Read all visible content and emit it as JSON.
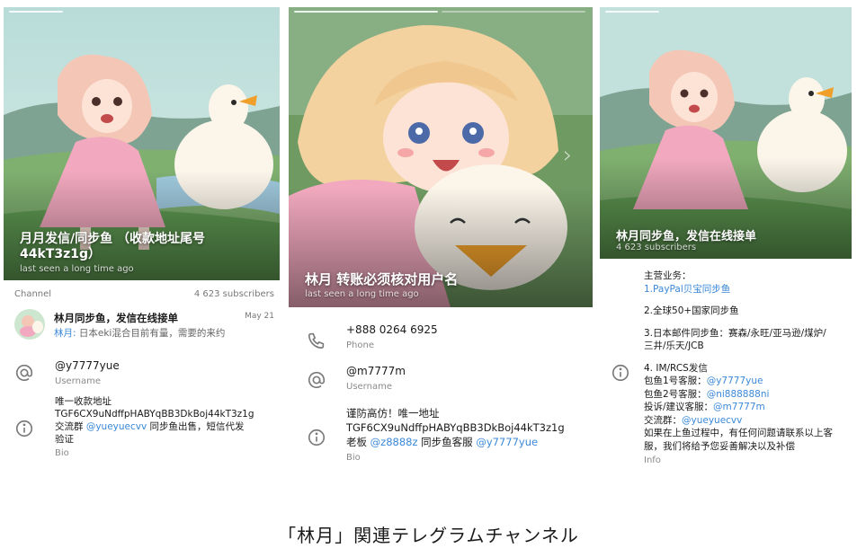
{
  "panel1": {
    "hero_name": "月月发信/同步鱼 （收款地址尾号44kT3z1g）",
    "hero_status": "last seen a long time ago",
    "channel_label": "Channel",
    "subscribers": "4 623 subscribers",
    "post": {
      "title": "林月同步鱼，发信在线接单",
      "date": "May 21",
      "preview_author": "林月:",
      "preview_text": " 日本eki混合目前有量，需要的来约"
    },
    "username": "@y7777yue",
    "username_label": "Username",
    "bio_line1": "唯一收款地址",
    "bio_line2": "TGF6CX9uNdffpHABYqBB3DkBoj44kT3z1g",
    "bio_line3_pre": "交流群 ",
    "bio_line3_link": "@yueyuecvv",
    "bio_line3_post": " 同步鱼出售，短信代发",
    "bio_line4": "验证",
    "bio_label": "Bio"
  },
  "panel2": {
    "hero_name": "林月 转账必须核对用户名",
    "hero_status": "last seen a long time ago",
    "phone": "+888 0264 6925",
    "phone_label": "Phone",
    "username": "@m7777m",
    "username_label": "Username",
    "bio_line1": "谨防高仿！唯一地址",
    "bio_line2": "TGF6CX9uNdffpHABYqBB3DkBoj44kT3z1g",
    "bio_line3_pre": "老板 ",
    "bio_line3_link1": "@z8888z",
    "bio_line3_mid": " 同步鱼客服 ",
    "bio_line3_link2": "@y7777yue",
    "bio_label": "Bio"
  },
  "panel3": {
    "hero_name": "林月同步鱼，发信在线接单",
    "hero_subscribers": "4 623 subscribers",
    "info": {
      "l1": "主营业务：",
      "l2": "1.PayPal贝宝同步鱼",
      "l3": "2.全球50+国家同步鱼",
      "l4": "3.日本邮件同步鱼：赛森/永旺/亚马逊/煤炉/",
      "l5": "三井/乐天/JCB",
      "l6": "4. IM/RCS发信",
      "l7_pre": "包鱼1号客服：",
      "l7_link": "@y7777yue",
      "l8_pre": "包鱼2号客服：",
      "l8_link": "@ni888888ni",
      "l9_pre": "投诉/建议客服：",
      "l9_link": "@m7777m",
      "l10_pre": "交流群：",
      "l10_link": "@yueyuecvv",
      "l11": "如果在上鱼过程中，有任何问题请联系以上客",
      "l12": "服，我们将给予您妥善解决以及补偿",
      "label": "Info"
    }
  },
  "caption": "「林月」関連テレグラムチャンネル",
  "colors": {
    "link": "#3b88d8",
    "muted": "#8a8a8a",
    "icon": "#7a7a7a"
  }
}
